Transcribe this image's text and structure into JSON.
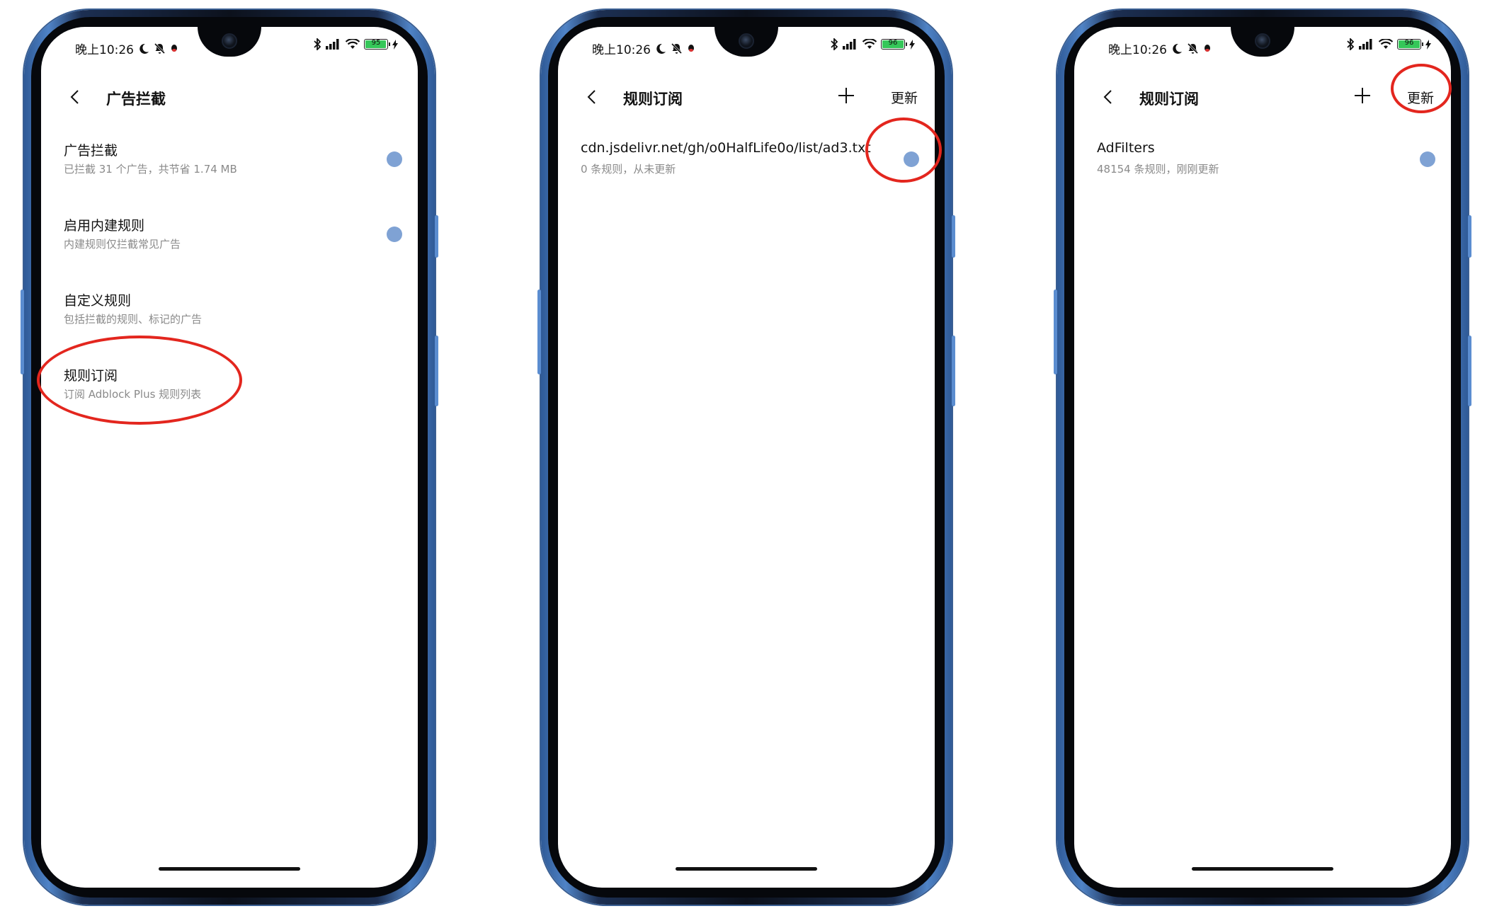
{
  "accent_color": "#7fa2d4",
  "highlight_color": "#e3261e",
  "screens": [
    {
      "status": {
        "time": "晚上10:26",
        "battery": "95"
      },
      "nav": {
        "title": "广告拦截",
        "update_label": ""
      },
      "items": [
        {
          "title": "广告拦截",
          "subtitle": "已拦截 31 个广告，共节省 1.74 MB",
          "toggle": true
        },
        {
          "title": "启用内建规则",
          "subtitle": "内建规则仅拦截常见广告",
          "toggle": true
        },
        {
          "title": "自定义规则",
          "subtitle": "包括拦截的规则、标记的广告",
          "toggle": false
        },
        {
          "title": "规则订阅",
          "subtitle": "订阅 Adblock Plus 规则列表",
          "toggle": false
        }
      ]
    },
    {
      "status": {
        "time": "晚上10:26",
        "battery": "96"
      },
      "nav": {
        "title": "规则订阅",
        "update_label": "更新"
      },
      "items": [
        {
          "title": "cdn.jsdelivr.net/gh/o0HalfLife0o/list/ad3.txt",
          "subtitle": "0 条规则，从未更新",
          "toggle": true
        }
      ]
    },
    {
      "status": {
        "time": "晚上10:26",
        "battery": "96"
      },
      "nav": {
        "title": "规则订阅",
        "update_label": "更新"
      },
      "items": [
        {
          "title": "AdFilters",
          "subtitle": "48154 条规则，刚刚更新",
          "toggle": true
        }
      ]
    }
  ]
}
